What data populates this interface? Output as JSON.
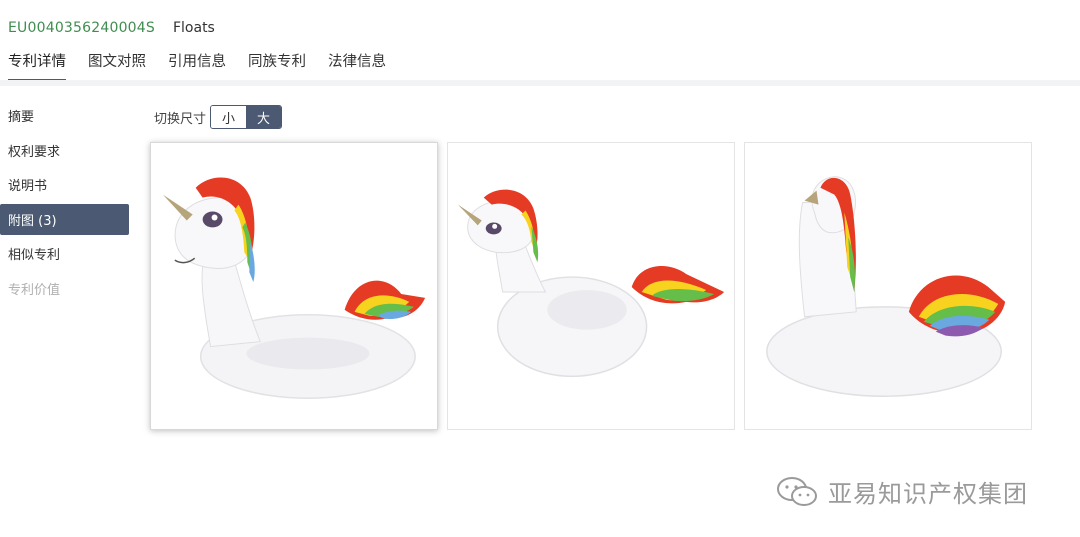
{
  "header": {
    "patent_id": "EU004035624000​4S",
    "title": "Floats"
  },
  "tabs": [
    {
      "label": "专利详情",
      "active": true
    },
    {
      "label": "图文对照",
      "active": false
    },
    {
      "label": "引用信息",
      "active": false
    },
    {
      "label": "同族专利",
      "active": false
    },
    {
      "label": "法律信息",
      "active": false
    }
  ],
  "sidebar": {
    "items": [
      {
        "label": "摘要"
      },
      {
        "label": "权利要求"
      },
      {
        "label": "说明书"
      },
      {
        "label": "附图 (3)"
      },
      {
        "label": "相似专利"
      },
      {
        "label": "专利价值"
      }
    ]
  },
  "size_switch": {
    "label": "切换尺寸",
    "small": "小",
    "large": "大",
    "selected": "大"
  },
  "figures": [
    {
      "icon": "unicorn-float-front-icon"
    },
    {
      "icon": "unicorn-float-perspective-icon"
    },
    {
      "icon": "unicorn-float-rear-icon"
    }
  ],
  "watermark": {
    "text": "亚易知识产权集团",
    "icon": "wechat-icon"
  },
  "colors": {
    "accent": "#4b5a72",
    "patent_id": "#3f8e4f"
  }
}
